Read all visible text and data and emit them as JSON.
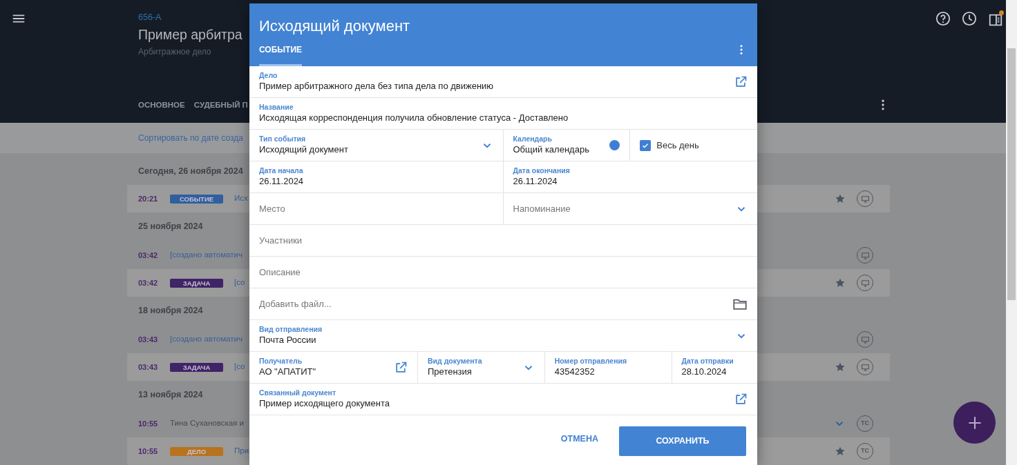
{
  "header": {
    "case_number": "656-А",
    "title": "Пример арбитра",
    "subtitle": "Арбитражное дело",
    "tabs": [
      {
        "label": "ОСНОВНОЕ",
        "selected": false
      },
      {
        "label": "СУДЕБНЫЙ П",
        "selected": false
      }
    ],
    "notification": true
  },
  "sort_link": "Сортировать по дате созда",
  "timeline": [
    {
      "date": "Сегодня, 26 ноября 2024",
      "entries": [
        {
          "kind": "card",
          "time": "20:21",
          "badge": "СОБЫТИЕ",
          "color": "#2f5f9e",
          "text": "Исх",
          "link": true,
          "starred": true
        }
      ]
    },
    {
      "date": "25 ноября 2024",
      "entries": [
        {
          "kind": "note",
          "time": "03:42",
          "text": "[создано автоматич",
          "link": true
        },
        {
          "kind": "card",
          "time": "03:42",
          "badge": "ЗАДАЧА",
          "color": "#3f2466",
          "text": "[со",
          "link": true,
          "starred": true
        }
      ]
    },
    {
      "date": "18 ноября 2024",
      "entries": [
        {
          "kind": "note",
          "time": "03:43",
          "text": "[создано автоматич",
          "link": true
        },
        {
          "kind": "card",
          "time": "03:43",
          "badge": "ЗАДАЧА",
          "color": "#3f2466",
          "text": "[со",
          "link": true,
          "starred": true
        }
      ]
    },
    {
      "date": "13 ноября 2024",
      "entries": [
        {
          "kind": "note",
          "time": "10:55",
          "text": "Тина Сухановская и",
          "link": false,
          "expandable": true,
          "initials": "ТС"
        },
        {
          "kind": "card",
          "time": "10:55",
          "badge": "ДЕЛО",
          "color": "#b8731f",
          "text": "При",
          "link": true,
          "starred": true,
          "initials": "ТС"
        }
      ]
    }
  ],
  "dialog": {
    "title": "Исходящий документ",
    "tabs": [
      {
        "label": "СОБЫТИЕ",
        "selected": true
      }
    ],
    "rows": [
      [
        {
          "kind": "field",
          "label": "Дело",
          "value": "Пример арбитражного дела без типа дела по движению",
          "opens_link": true
        }
      ],
      [
        {
          "kind": "field",
          "label": "Название",
          "value": "Исходящая корреспонденция получила обновление статуса - Доставлено"
        }
      ],
      [
        {
          "kind": "field",
          "label": "Тип события",
          "value": "Исходящий документ",
          "dropdown": true
        },
        {
          "kind": "field",
          "label": "Календарь",
          "value": "Общий календарь",
          "color": "#3f7fd3"
        },
        {
          "kind": "checkbox",
          "label": "Весь день",
          "checked": true
        }
      ],
      [
        {
          "kind": "field",
          "label": "Дата начала",
          "value": "26.11.2024"
        },
        {
          "kind": "field",
          "label": "Дата окончания",
          "value": "26.11.2024"
        }
      ],
      [
        {
          "kind": "field",
          "placeholder": "Место"
        },
        {
          "kind": "field",
          "placeholder": "Напоминание",
          "dropdown": true
        }
      ],
      [
        {
          "kind": "field",
          "placeholder": "Участники"
        }
      ],
      [
        {
          "kind": "field",
          "placeholder": "Описание"
        }
      ],
      [
        {
          "kind": "field",
          "placeholder": "Добавить файл...",
          "attach": true
        }
      ],
      [
        {
          "kind": "field",
          "label": "Вид отправления",
          "value": "Почта России",
          "dropdown": true
        }
      ],
      [
        {
          "kind": "field",
          "label": "Получатель",
          "value": "АО \"АПАТИТ\"",
          "opens_link": true
        },
        {
          "kind": "field",
          "label": "Вид документа",
          "value": "Претензия",
          "dropdown": true
        },
        {
          "kind": "field",
          "label": "Номер отправления",
          "value": "43542352"
        },
        {
          "kind": "field",
          "label": "Дата отправки",
          "value": "28.10.2024"
        }
      ],
      [
        {
          "kind": "field",
          "label": "Связанный документ",
          "value": "Пример исходящего документа",
          "opens_link": true
        }
      ]
    ],
    "cancel": "ОТМЕНА",
    "save": "СОХРАНИТЬ"
  }
}
